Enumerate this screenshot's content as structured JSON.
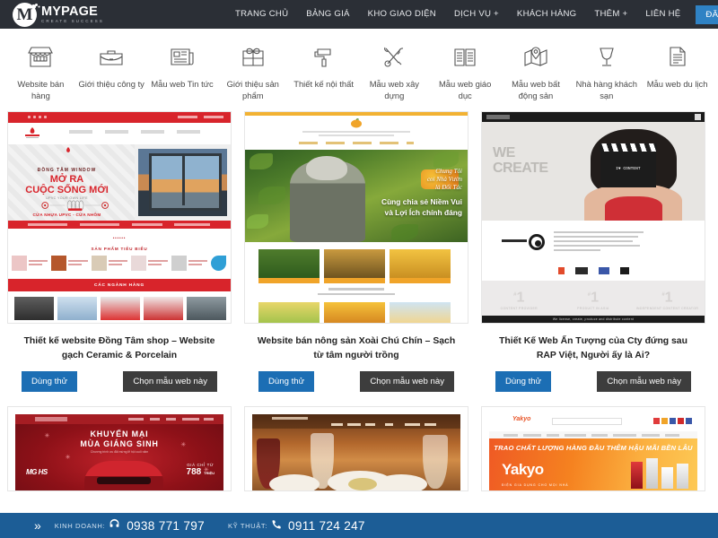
{
  "header": {
    "logo": {
      "name": "MYPAGE",
      "tagline": "CREATE SUCCESS",
      "letter": "M"
    },
    "nav": [
      {
        "label": "TRANG CHỦ"
      },
      {
        "label": "BẢNG GIÁ"
      },
      {
        "label": "KHO GIAO DIỆN"
      },
      {
        "label": "DỊCH VỤ +"
      },
      {
        "label": "KHÁCH HÀNG"
      },
      {
        "label": "THÊM +"
      },
      {
        "label": "LIÊN HỆ"
      }
    ],
    "register_label": "ĐĂNG KÝ",
    "bar_color": "#2b2f36",
    "register_color": "#2f82c4"
  },
  "categories": [
    {
      "label": "Website bán hàng",
      "icon": "storefront-icon"
    },
    {
      "label": "Giới thiệu công ty",
      "icon": "briefcase-icon"
    },
    {
      "label": "Mẫu web Tin tức",
      "icon": "newspaper-icon"
    },
    {
      "label": "Giới thiệu sản phẩm",
      "icon": "product-box-icon"
    },
    {
      "label": "Thiết kế nội thất",
      "icon": "paint-roller-icon"
    },
    {
      "label": "Mẫu web xây dựng",
      "icon": "tools-icon"
    },
    {
      "label": "Mẫu web giáo dục",
      "icon": "open-book-icon"
    },
    {
      "label": "Mẫu web bất động sản",
      "icon": "map-pin-icon"
    },
    {
      "label": "Nhà hàng khách sạn",
      "icon": "wine-glass-icon"
    },
    {
      "label": "Mẫu web du lịch",
      "icon": "document-icon"
    }
  ],
  "buttons": {
    "try_label": "Dùng thử",
    "pick_label": "Chọn mẫu web này"
  },
  "cards_row1": [
    {
      "title": "Thiết kế website Đồng Tâm shop – Website gạch Ceramic & Porcelain",
      "preview": {
        "brand": "ĐỒNG TÂM WINDOW",
        "headline_1": "MỞ RA",
        "headline_2": "CUỘC SỐNG MỚI",
        "subline": "UPVC YOUR OWN LIFE",
        "footline": "CỬA NHỰA UPVC - CỬA NHÔM",
        "section_1": "SẢN PHẨM TIÊU BIỂU",
        "section_2": "CÁC NGÀNH HÀNG",
        "accent": "#d8242b"
      }
    },
    {
      "title": "Website bán nông sản Xoài Chú Chín – Sạch từ tâm người trồng",
      "preview": {
        "headline_1": "Chung Tôi",
        "headline_2": "coi Nhà Vườn",
        "headline_3": "là Đối Tác",
        "headline_4": "Cùng chia sẻ Niềm Vui",
        "headline_5": "và Lợi Ích chính đáng",
        "accent": "#f2b233"
      }
    },
    {
      "title": "Thiết Kế Web Ấn Tượng của Cty đứng sau RAP Việt, Người ấy là Ai?",
      "preview": {
        "headline_1": "WE",
        "headline_2": "CREATE",
        "clapper_text": "I♥ CONTENT",
        "stats": [
          {
            "num": "1",
            "caption": "CONTENT PROVIDER"
          },
          {
            "num": "1",
            "caption": "PRODUCT IN ASIA"
          },
          {
            "num": "1",
            "caption": "INDEPENDENT CONTENT CREATOR"
          }
        ],
        "footer": "We license, create, produce and distribute content",
        "accent": "#cf2f36"
      }
    }
  ],
  "cards_row2": [
    {
      "preview": {
        "headline_1": "KHUYẾN MẠI",
        "headline_2": "MÙA GIÁNG SINH",
        "subline": "Chương trình ưu đãi mừng lễ hội cuối năm",
        "brand": "MG HS",
        "price_label": "GIÁ CHỈ TỪ",
        "price_value": "788",
        "price_unit": "TRIỆU",
        "accent": "#c0222a"
      }
    },
    {
      "preview": {
        "theme": "restaurant-dining",
        "accent": "#b2672c"
      }
    },
    {
      "preview": {
        "brand": "Yakyo",
        "brand_sub": "ĐIỆN GIA DỤNG CHO MỌI NHÀ",
        "banner": "TRAO CHẤT LƯỢNG HÀNG ĐẦU THÊM HẬU MÃI BỀN LÂU",
        "accent": "#f58220"
      }
    }
  ],
  "hotline": {
    "chevron": "»",
    "items": [
      {
        "label": "KINH DOANH:",
        "icon": "headset-icon",
        "number": "0938 771 797"
      },
      {
        "label": "KỸ THUẬT:",
        "icon": "phone-icon",
        "number": "0911 724 247"
      }
    ],
    "bar_color": "#1c5d96"
  }
}
